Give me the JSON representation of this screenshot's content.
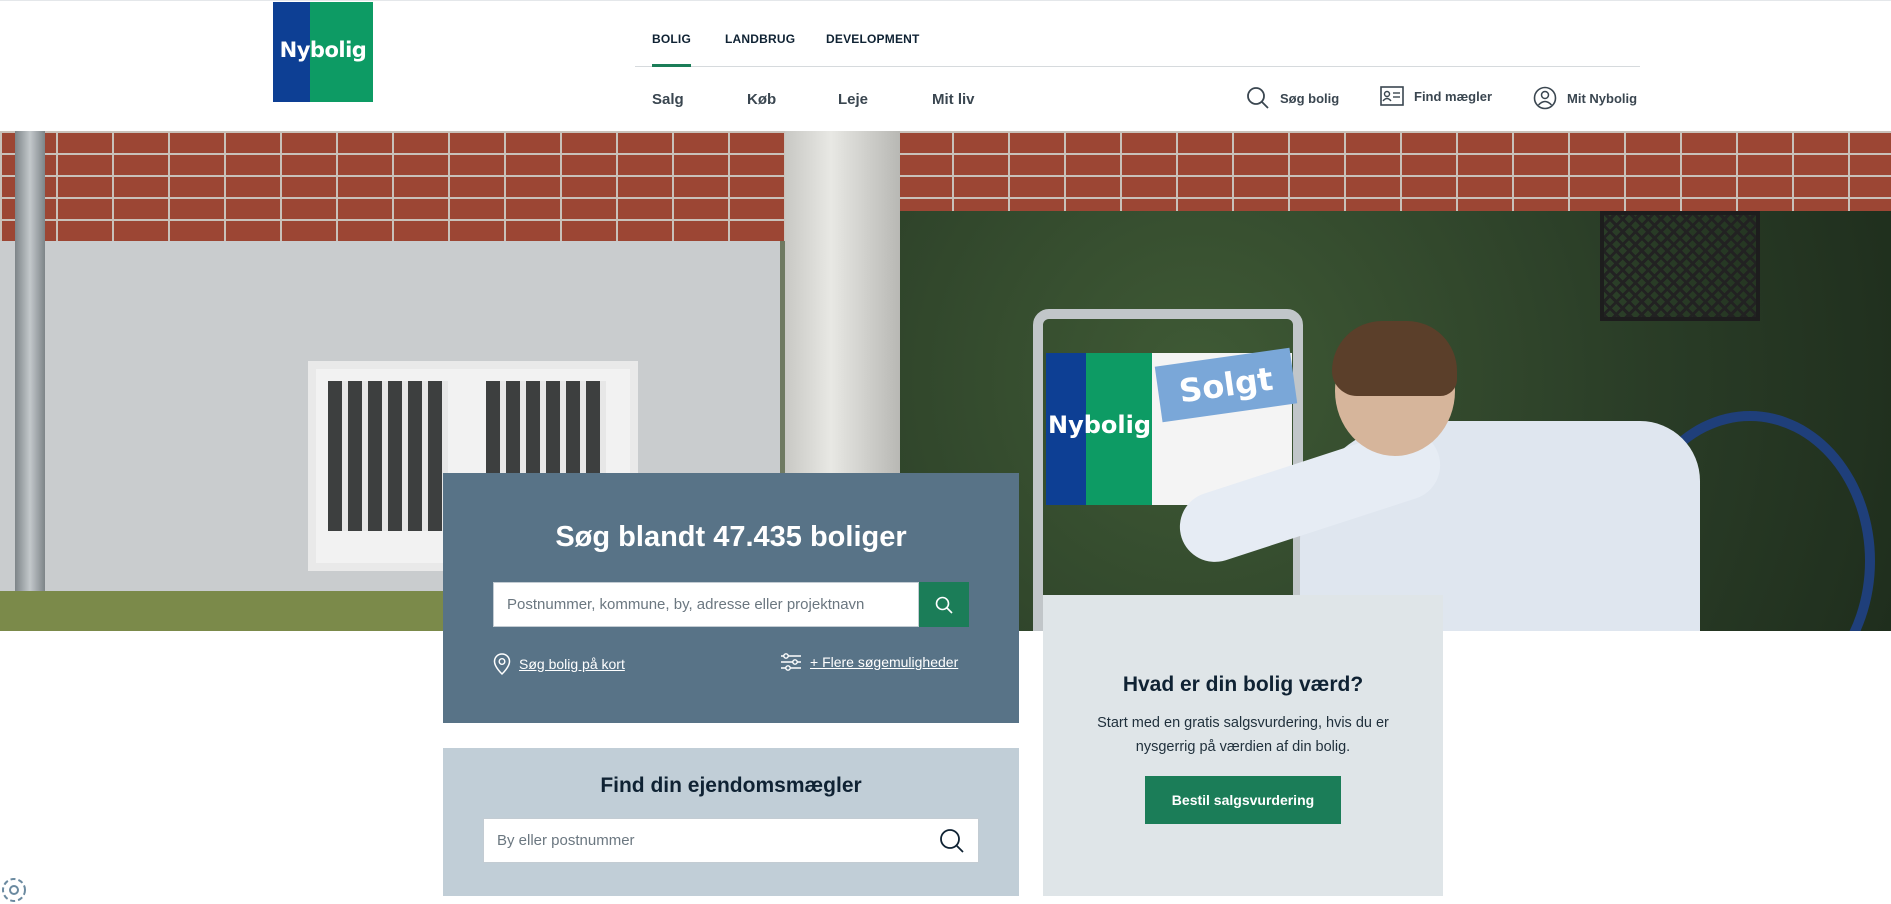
{
  "brand": {
    "logo_text": "Nybolig",
    "blue": "#0d3f94",
    "green": "#0d9b64",
    "accent": "#1b7d58"
  },
  "top_tabs": [
    {
      "label": "BOLIG",
      "active": true
    },
    {
      "label": "LANDBRUG",
      "active": false
    },
    {
      "label": "DEVELOPMENT",
      "active": false
    }
  ],
  "main_nav": [
    "Salg",
    "Køb",
    "Leje",
    "Mit liv"
  ],
  "utility_nav": {
    "search": {
      "label": "Søg bolig",
      "icon": "search-icon"
    },
    "agent": {
      "label": "Find mægler",
      "icon": "id-card-icon"
    },
    "account": {
      "label": "Mit Nybolig",
      "icon": "user-icon"
    }
  },
  "hero": {
    "sign_text": "Nybolig",
    "sold_sticker": "Solgt"
  },
  "search": {
    "title": "Søg blandt 47.435 boliger",
    "placeholder": "Postnummer, kommune, by, adresse eller projektnavn",
    "map_link": "Søg bolig på kort",
    "more_link": "+ Flere søgemuligheder"
  },
  "agent_search": {
    "title": "Find din ejendomsmægler",
    "placeholder": "By eller postnummer"
  },
  "valuation": {
    "title": "Hvad er din bolig værd?",
    "text": "Start med en gratis salgsvurdering, hvis du er nysgerrig på værdien af din bolig.",
    "button": "Bestil salgsvurdering"
  }
}
